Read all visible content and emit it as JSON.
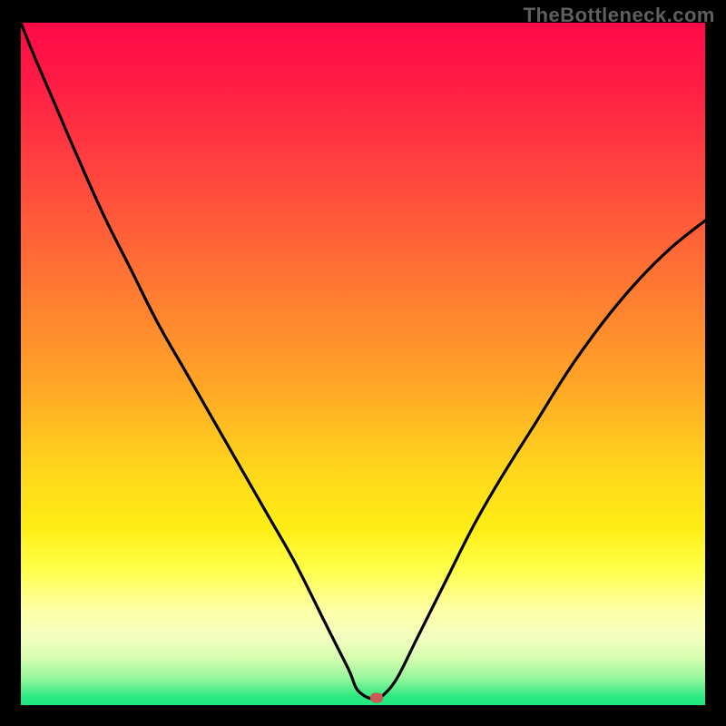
{
  "watermark": "TheBottleneck.com",
  "chart_data": {
    "type": "line",
    "title": "",
    "xlabel": "",
    "ylabel": "",
    "xlim": [
      0,
      100
    ],
    "ylim": [
      0,
      100
    ],
    "x": [
      0,
      2,
      5,
      8,
      12,
      16,
      20,
      24,
      28,
      32,
      36,
      40,
      44,
      46,
      48,
      49,
      50,
      51,
      52,
      53,
      55,
      58,
      62,
      66,
      70,
      75,
      80,
      85,
      90,
      95,
      100
    ],
    "values": [
      100,
      95,
      88,
      81,
      72,
      64,
      56,
      49,
      42,
      35,
      28,
      21,
      13,
      9,
      5,
      2.5,
      1.5,
      1,
      1,
      1.5,
      4,
      10,
      18,
      26,
      33,
      41,
      49,
      56,
      62,
      67,
      71
    ],
    "minimum_point": {
      "x": 52,
      "y": 1
    },
    "flat_bottom": {
      "x_start": 49,
      "x_end": 53,
      "y": 1
    },
    "colors": {
      "curve": "#000000",
      "marker": "#ca5a54",
      "gradient_top": "#ff0a46",
      "gradient_bottom": "#22e780",
      "background": "#000000"
    }
  }
}
